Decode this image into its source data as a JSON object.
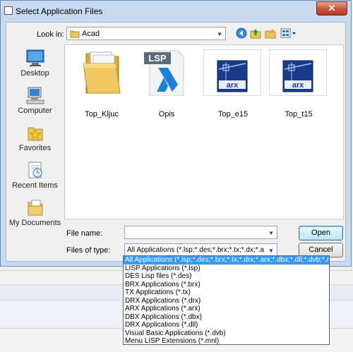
{
  "window": {
    "title": "Select Application Files",
    "close_label": "✕"
  },
  "toolbar": {
    "look_in_label": "Look in:",
    "look_in_value": "Acad"
  },
  "places": [
    {
      "label": "Desktop",
      "icon": "desktop-icon"
    },
    {
      "label": "Computer",
      "icon": "computer-icon"
    },
    {
      "label": "Favorites",
      "icon": "favorites-icon"
    },
    {
      "label": "Recent Items",
      "icon": "recent-items-icon"
    },
    {
      "label": "My Documents",
      "icon": "my-documents-icon"
    }
  ],
  "files": [
    {
      "name": "Top_Kljuc",
      "icon": "folder-icon"
    },
    {
      "name": "Opis",
      "icon": "lsp-file-icon",
      "badge": "LSP"
    },
    {
      "name": "Top_e15",
      "icon": "arx-file-icon",
      "badge": "arx"
    },
    {
      "name": "Top_t15",
      "icon": "arx-file-icon",
      "badge": "arx"
    }
  ],
  "fields": {
    "file_name_label": "File name:",
    "file_name_value": "",
    "file_type_label": "Files of type:",
    "file_type_value": "All Applications (*.lsp;*.des;*.brx;*.tx;*.dx;*.arx;*"
  },
  "buttons": {
    "open": "Open",
    "cancel": "Cancel"
  },
  "file_type_options": [
    "All Applications (*.lsp;*.des;*.brx;*.tx;*.drx;*.arx;*.dbx;*.dll;*.dvb;*.mnl;*)",
    "LISP Applications (*.lsp)",
    "DES Lisp files (*.des)",
    "BRX Applications (*.brx)",
    "TX Applications (*.tx)",
    "DRX Applications (*.drx)",
    "ARX Applications (*.arx)",
    "DBX Applications (*.dbx)",
    "DRX Applications (*.dll)",
    "Visual Basic Applications (*.dvb)",
    "Menu LISP Extensions (*.mnl)"
  ],
  "colors": {
    "selection": "#3399ff",
    "dialog_frame": "#c7daf0",
    "arx_tile": "#1a3a8a"
  }
}
